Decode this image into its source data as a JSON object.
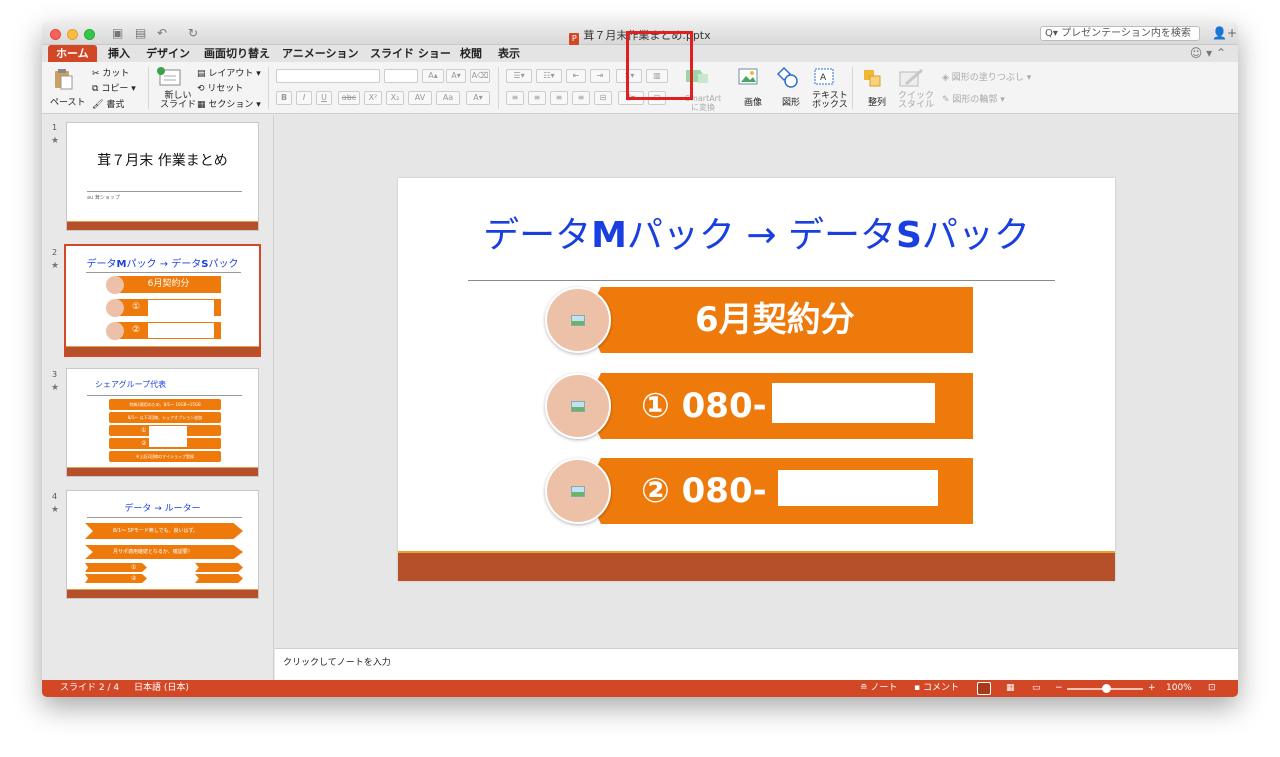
{
  "window": {
    "title": "茸７月末作業まとめ.pptx",
    "search_placeholder": "プレゼンテーション内を検索"
  },
  "tabs": [
    "ホーム",
    "挿入",
    "デザイン",
    "画面切り替え",
    "アニメーション",
    "スライド ショー",
    "校閲",
    "表示"
  ],
  "ribbon": {
    "paste": "ペースト",
    "cut": "カット",
    "copy": "コピー",
    "format": "書式",
    "new_slide_1": "新しい",
    "new_slide_2": "スライド",
    "layout": "レイアウト",
    "reset": "リセット",
    "section": "セクション",
    "smartart_1": "SmartArt",
    "smartart_2": "に変換",
    "picture": "画像",
    "shapes": "図形",
    "textbox_1": "テキスト",
    "textbox_2": "ボックス",
    "arrange": "整列",
    "quick_style_1": "クイック",
    "quick_style_2": "スタイル",
    "shape_fill": "図形の塗りつぶし",
    "shape_outline": "図形の輪郭"
  },
  "thumbnails": [
    {
      "num": "1",
      "title": "茸７月末 作業まとめ",
      "sub": "au 茸ショップ"
    },
    {
      "num": "2",
      "title_a": "データ",
      "title_b": "M",
      "title_c": "パック → データ",
      "title_d": "S",
      "title_e": "パック",
      "row1": "6月契約分",
      "row2": "①",
      "row3": "②"
    },
    {
      "num": "3",
      "title": "シェアグループ代表",
      "r1": "特典2適用のため、8/1～ 10GB→15GB",
      "r2": "8/1～ 以下2回線、シェアオプション追加",
      "r3": "①",
      "r4": "②",
      "r5": "※上記2回線のマイショップ登録"
    },
    {
      "num": "4",
      "title": "データ → ルーター",
      "r1": "8/1～ SPモード無しでも、良いはず。",
      "r2": "月サポ適用継続となるか、確認要！",
      "r3": "①",
      "r4": "②"
    }
  ],
  "slide": {
    "title_a": "データ",
    "title_b": "M",
    "title_c": "パック → データ",
    "title_d": "S",
    "title_e": "パック",
    "row1": "6月契約分",
    "row2": "①  080-",
    "row3": "②  080-"
  },
  "notes_placeholder": "クリックしてノートを入力",
  "status": {
    "slide_pos": "スライド 2 / 4",
    "language": "日本語 (日本)",
    "notes": "ノート",
    "comments": "コメント",
    "zoom": "100%",
    "zoom_level_percent": 100
  }
}
